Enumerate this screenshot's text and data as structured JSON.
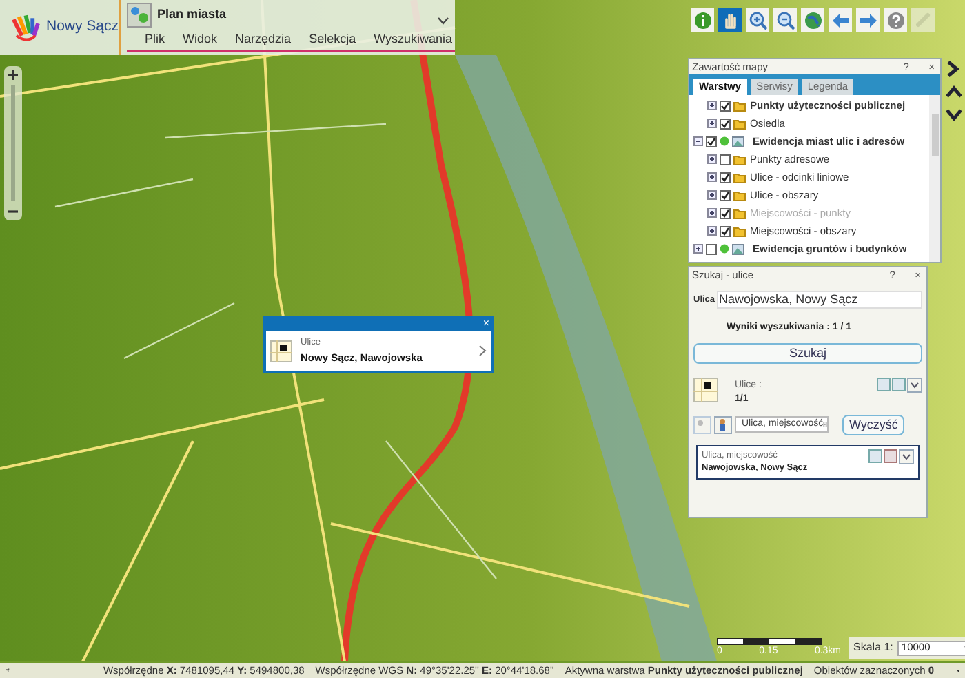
{
  "header": {
    "logo_text": "Nowy Sącz",
    "app_title": "Plan miasta",
    "menu": [
      "Plik",
      "Widok",
      "Narzędzia",
      "Selekcja",
      "Wyszukiwania"
    ]
  },
  "toolbar": [
    {
      "kind": "info",
      "selected": false,
      "disabled": false
    },
    {
      "kind": "pan",
      "selected": true,
      "disabled": false
    },
    {
      "kind": "zoom-in",
      "selected": false,
      "disabled": false
    },
    {
      "kind": "zoom-out",
      "selected": false,
      "disabled": false
    },
    {
      "kind": "globe",
      "selected": false,
      "disabled": false
    },
    {
      "kind": "back",
      "selected": false,
      "disabled": false
    },
    {
      "kind": "forward",
      "selected": false,
      "disabled": false
    },
    {
      "kind": "help",
      "selected": false,
      "disabled": false
    },
    {
      "kind": "link",
      "selected": false,
      "disabled": true
    }
  ],
  "layers_panel": {
    "title": "Zawartość mapy",
    "controls": [
      "?",
      "_",
      "×"
    ],
    "tabs": [
      {
        "label": "Warstwy",
        "selected": true
      },
      {
        "label": "Serwisy",
        "selected": false
      },
      {
        "label": "Legenda",
        "selected": false
      }
    ],
    "layers": [
      {
        "children": [
          {
            "label": "Punkty użyteczności publicznej",
            "checked": true,
            "active": true,
            "disabled": false
          },
          {
            "label": "Osiedla",
            "checked": true,
            "active": false,
            "disabled": false
          }
        ]
      },
      {
        "label": "Ewidencja miast ulic i adresów",
        "checked": true,
        "expanded": true,
        "children": [
          {
            "label": "Punkty adresowe",
            "checked": false,
            "active": false,
            "disabled": false
          },
          {
            "label": "Ulice - odcinki liniowe",
            "checked": true,
            "active": false,
            "disabled": false
          },
          {
            "label": "Ulice - obszary",
            "checked": true,
            "active": false,
            "disabled": false
          },
          {
            "label": "Miejscowości - punkty",
            "checked": true,
            "active": false,
            "disabled": true
          },
          {
            "label": "Miejscowości - obszary",
            "checked": true,
            "active": false,
            "disabled": false
          }
        ]
      },
      {
        "label": "Ewidencja gruntów i budynków",
        "checked": false,
        "expanded": false
      }
    ]
  },
  "search_panel": {
    "title": "Szukaj - ulice",
    "controls": [
      "?",
      "_",
      "×"
    ],
    "field_label": "Ulica",
    "field_value": "Nawojowska, Nowy Sącz",
    "results_text": "Wyniki wyszukiwania : 1 / 1",
    "search_button": "Szukaj",
    "result_group": "Ulice :",
    "result_count": "1/1",
    "mode_select": "Ulica, miejscowość",
    "clear_button": "Wyczyść",
    "result": {
      "label": "Ulica, miejscowość",
      "value": "Nawojowska, Nowy Sącz"
    }
  },
  "popup": {
    "layer": "Ulice",
    "name": "Nowy Sącz, Nawojowska",
    "close": "×"
  },
  "scale": {
    "ticks": [
      "0",
      "0.15",
      "0.3km"
    ],
    "label": "Skala 1:",
    "value": "10000"
  },
  "status_bar": [
    "Współrzędne **X:** 7481095,44 **Y:** 5494800,38",
    "Współrzędne WGS **N:** 49°35'22.25'' **E:** 20°44'18.68''",
    "Aktywna warstwa **Punkty użyteczności publicznej**",
    "Obiektów zaznaczonych **0**"
  ]
}
